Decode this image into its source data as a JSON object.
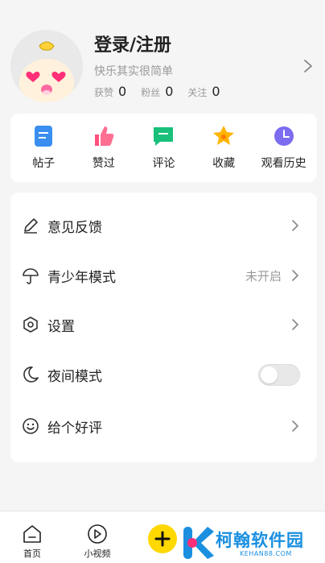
{
  "profile": {
    "login_label": "登录/注册",
    "slogan": "快乐其实很简单",
    "stats": [
      {
        "label": "获赞",
        "value": "0"
      },
      {
        "label": "粉丝",
        "value": "0"
      },
      {
        "label": "关注",
        "value": "0"
      }
    ]
  },
  "shortcuts": [
    {
      "label": "帖子",
      "icon": "post-icon"
    },
    {
      "label": "赞过",
      "icon": "thumbs-up-icon"
    },
    {
      "label": "评论",
      "icon": "comment-icon"
    },
    {
      "label": "收藏",
      "icon": "star-icon"
    },
    {
      "label": "观看历史",
      "icon": "clock-icon"
    }
  ],
  "menu": [
    {
      "label": "意见反馈",
      "icon": "pencil-icon"
    },
    {
      "label": "青少年模式",
      "icon": "umbrella-icon",
      "value": "未开启"
    },
    {
      "label": "设置",
      "icon": "gear-icon"
    },
    {
      "label": "夜间模式",
      "icon": "moon-icon",
      "toggle_on": false
    },
    {
      "label": "给个好评",
      "icon": "smile-icon"
    }
  ],
  "bottom_nav": [
    {
      "label": "首页",
      "icon": "home-icon"
    },
    {
      "label": "小视频",
      "icon": "play-icon"
    }
  ],
  "watermark": {
    "title": "柯翰软件园",
    "subtitle": "KEHAN88.COM"
  },
  "colors": {
    "post": "#3a8ef0",
    "like": "#ff4f7a",
    "comment": "#19c07a",
    "star": "#ffb400",
    "history": "#7b6cf0",
    "plus": "#ffd800",
    "watermark": "#1a8fe0"
  }
}
